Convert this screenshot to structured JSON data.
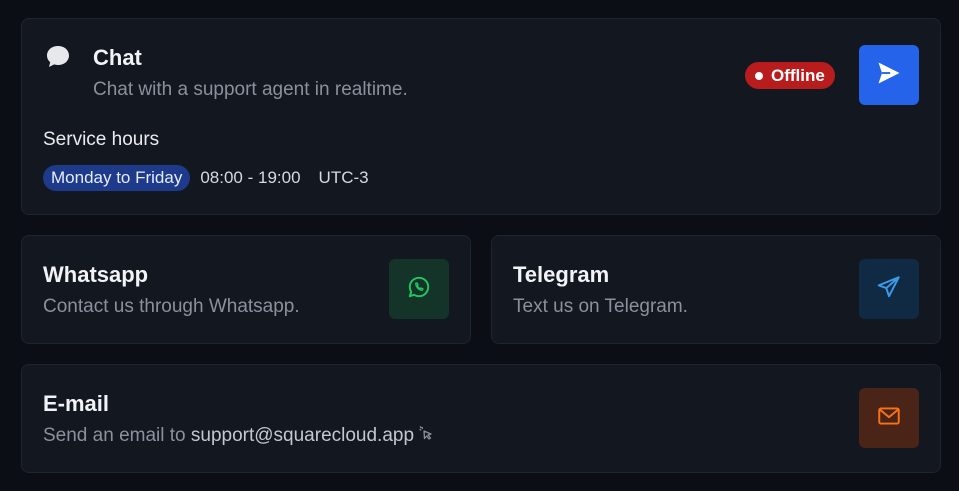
{
  "chat": {
    "title": "Chat",
    "description": "Chat with a support agent in realtime.",
    "status": "Offline",
    "status_color": "#b91c1c",
    "icon": "chat-bubble-icon",
    "action_icon": "send-icon",
    "action_color": "#2563eb",
    "hours": {
      "title": "Service hours",
      "days": "Monday to Friday",
      "time": "08:00 - 19:00",
      "timezone": "UTC-3"
    }
  },
  "whatsapp": {
    "title": "Whatsapp",
    "description": "Contact us through Whatsapp.",
    "icon": "whatsapp-icon",
    "icon_color": "#22c55e"
  },
  "telegram": {
    "title": "Telegram",
    "description": "Text us on Telegram.",
    "icon": "telegram-icon",
    "icon_color": "#3b9be8"
  },
  "email": {
    "title": "E-mail",
    "description_prefix": "Send an email to ",
    "address": "support@squarecloud.app",
    "icon": "mail-icon",
    "icon_color": "#f97316"
  }
}
